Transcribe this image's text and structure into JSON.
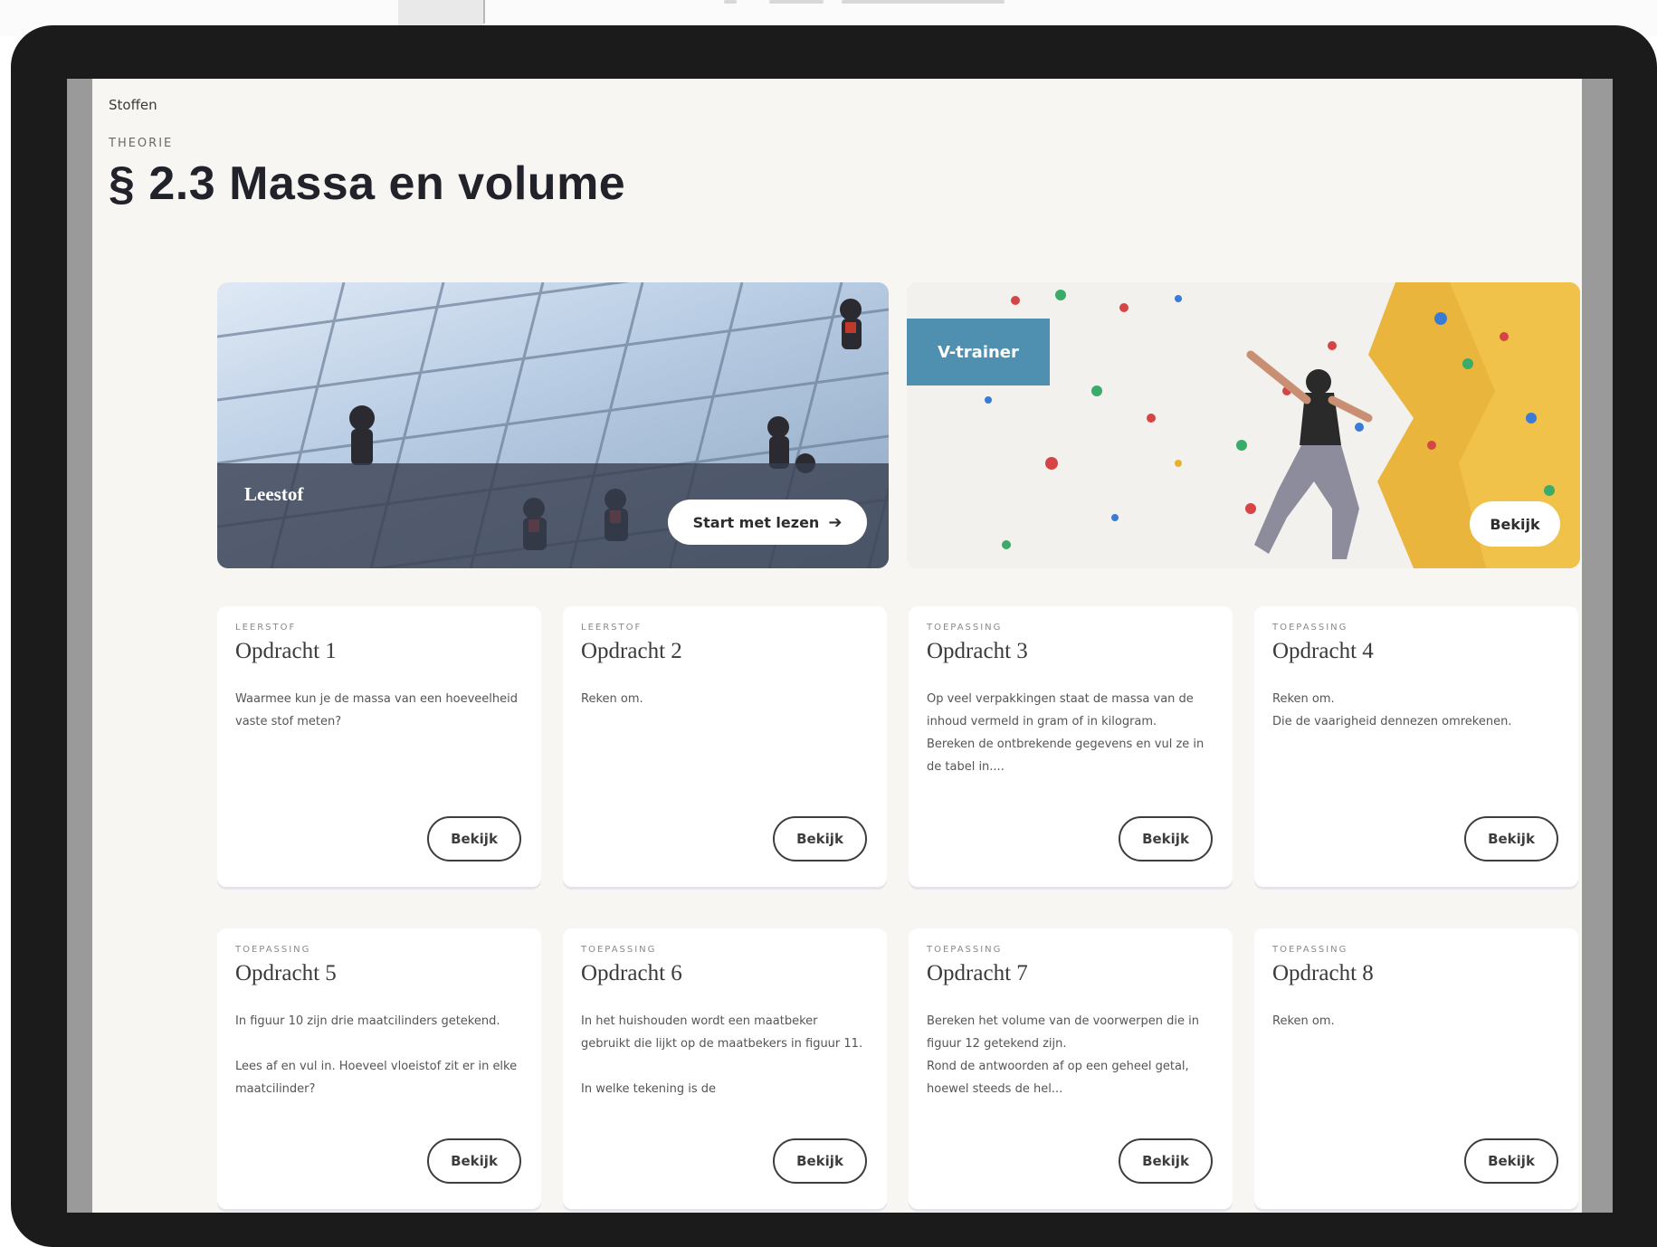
{
  "breadcrumb": "Stoffen",
  "kicker": "THEORIE",
  "title": "§ 2.3 Massa en volume",
  "hero_left": {
    "label": "Leestof",
    "button": "Start met lezen",
    "arrow": "➔"
  },
  "hero_right": {
    "badge": "V-trainer",
    "button": "Bekijk"
  },
  "cards": [
    {
      "kicker": "LEERSTOF",
      "title": "Opdracht 1",
      "desc": "Waarmee kun je de massa van een hoeveelheid vaste stof meten?",
      "button": "Bekijk"
    },
    {
      "kicker": "LEERSTOF",
      "title": "Opdracht 2",
      "desc": "Reken om.",
      "button": "Bekijk"
    },
    {
      "kicker": "TOEPASSING",
      "title": "Opdracht 3",
      "desc": "Op veel verpakkingen staat de massa van de inhoud vermeld in gram of in kilogram.\nBereken de ontbrekende gegevens en vul ze in de tabel in....",
      "button": "Bekijk"
    },
    {
      "kicker": "TOEPASSING",
      "title": "Opdracht 4",
      "desc": "Reken om.\nDie de vaarigheid dennezen omrekenen.",
      "button": "Bekijk"
    },
    {
      "kicker": "TOEPASSING",
      "title": "Opdracht 5",
      "desc": "In figuur 10 zijn drie maatcilinders getekend.\n\nLees af en vul in. Hoeveel vloeistof zit er in elke maatcilinder?",
      "button": "Bekijk"
    },
    {
      "kicker": "TOEPASSING",
      "title": "Opdracht 6",
      "desc": "In het huishouden wordt een maatbeker gebruikt die lijkt op de maatbekers in figuur 11.\n\nIn welke tekening is de",
      "button": "Bekijk"
    },
    {
      "kicker": "TOEPASSING",
      "title": "Opdracht 7",
      "desc": "Bereken het volume van de voorwerpen die in figuur 12 getekend zijn.\nRond de antwoorden af op een geheel getal, hoewel steeds de hel...",
      "button": "Bekijk"
    },
    {
      "kicker": "TOEPASSING",
      "title": "Opdracht 8",
      "desc": "Reken om.",
      "button": "Bekijk"
    }
  ],
  "colors": {
    "badge": "#4f8fb0",
    "screen_bg": "#f7f6f3",
    "frame": "#1b1b1b"
  }
}
